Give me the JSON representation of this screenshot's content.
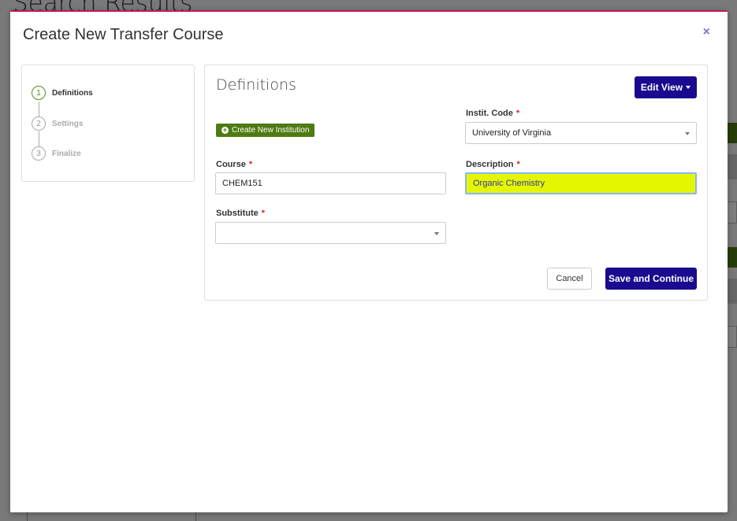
{
  "background": {
    "page_title": "Search Results"
  },
  "modal": {
    "title": "Create New Transfer Course",
    "close_label": "×"
  },
  "stepper": {
    "steps": [
      {
        "number": "1",
        "label": "Definitions",
        "active": true
      },
      {
        "number": "2",
        "label": "Settings",
        "active": false
      },
      {
        "number": "3",
        "label": "Finalize",
        "active": false
      }
    ]
  },
  "panel": {
    "title": "Definitions",
    "edit_view_label": "Edit View",
    "create_institution_label": "Create New Institution"
  },
  "form": {
    "instit_code": {
      "label": "Instit. Code",
      "required_mark": "*",
      "value": "University of Virginia"
    },
    "course": {
      "label": "Course",
      "required_mark": "*",
      "value": "CHEM151"
    },
    "description": {
      "label": "Description",
      "required_mark": "*",
      "value": "Organic Chemistry"
    },
    "substitute": {
      "label": "Substitute",
      "required_mark": "*",
      "value": ""
    }
  },
  "actions": {
    "cancel_label": "Cancel",
    "save_label": "Save and Continue"
  },
  "colors": {
    "primary": "#1a0a8f",
    "success": "#4e7a12",
    "highlight": "#e5f700",
    "required": "#d9232d",
    "modal_border": "#c2185b"
  }
}
